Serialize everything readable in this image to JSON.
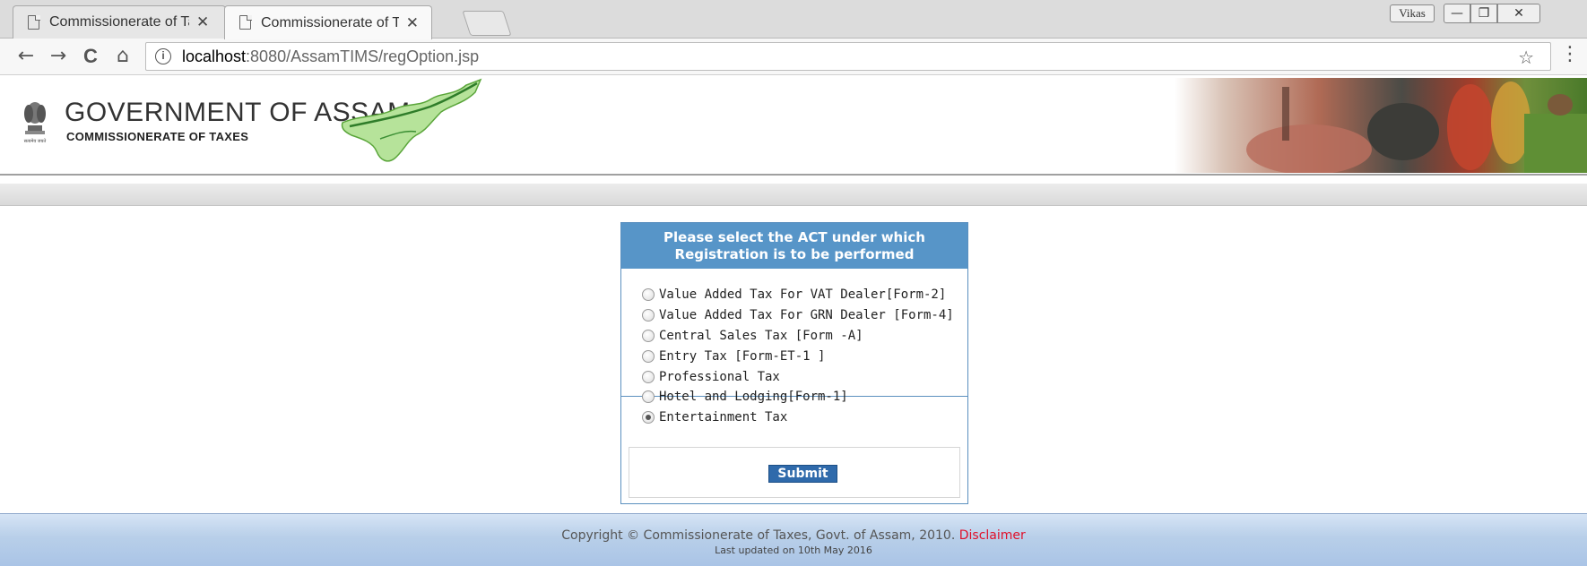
{
  "browser": {
    "tabs": [
      {
        "title": "Commissionerate of Taxes",
        "close": "✕"
      },
      {
        "title": "Commissionerate of Taxes",
        "close": "✕"
      }
    ],
    "user_button": "Vikas",
    "window_controls": {
      "minimize": "—",
      "maximize": "❐",
      "close": "✕"
    },
    "nav": {
      "back": "←",
      "forward": "→",
      "reload": "C",
      "home": "⌂"
    },
    "address": {
      "info": "i",
      "host": "localhost",
      "rest": ":8080/AssamTIMS/regOption.jsp"
    },
    "star": "☆",
    "menu": "⋮"
  },
  "site": {
    "title": "GOVERNMENT OF ASSAM",
    "subtitle": "COMMISSIONERATE OF TAXES",
    "emblem_caption": "सत्यमेव जयते"
  },
  "form": {
    "heading_line1": "Please select the ACT under which",
    "heading_line2": "Registration is to be performed",
    "options": [
      {
        "label": "Value Added Tax For VAT Dealer[Form-2]",
        "checked": false
      },
      {
        "label": "Value Added Tax For GRN Dealer [Form-4]",
        "checked": false
      },
      {
        "label": "Central Sales Tax [Form -A]",
        "checked": false
      },
      {
        "label": "Entry Tax [Form-ET-1 ]",
        "checked": false
      },
      {
        "label": "Professional Tax",
        "checked": false
      },
      {
        "label": "Hotel and Lodging[Form-1]",
        "checked": false
      },
      {
        "label": "Entertainment Tax",
        "checked": true
      }
    ],
    "selected_option": "Entertainment Tax",
    "submit_label": "Submit"
  },
  "footer": {
    "copyright": "Copyright © Commissionerate of Taxes, Govt. of Assam, 2010.",
    "disclaimer": "Disclaimer",
    "updated": "Last updated on 10th May 2016"
  },
  "colors": {
    "panel_header": "#5795c8",
    "submit_button": "#2f6aab",
    "disclaimer_link": "#e0102a",
    "footer_band": "#b8cfe9"
  }
}
